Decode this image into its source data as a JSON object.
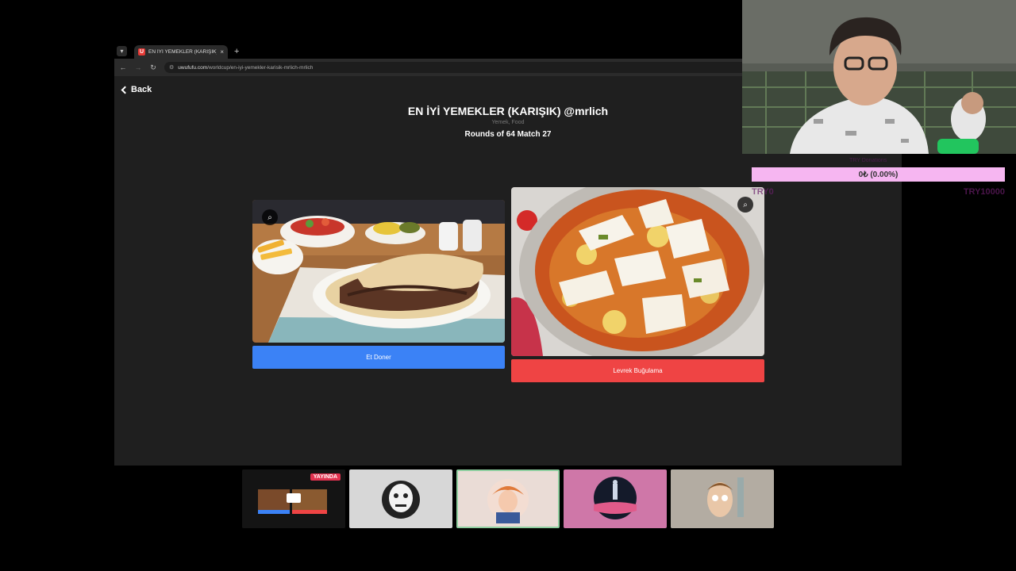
{
  "browser": {
    "tab_title": "EN İYİ YEMEKLER (KARIŞIK) @m",
    "tab_close": "×",
    "new_tab": "+",
    "url_domain": "uwufufu.com",
    "url_path": "/worldcup/en-iyi-yemekler-karisik-mrlich-mrlich"
  },
  "page": {
    "back_label": "Back",
    "title": "EN İYİ YEMEKLER (KARIŞIK) @mrlich",
    "subtitle": "Yemek, Food",
    "rounds": "Rounds of 64 Match 27"
  },
  "choices": [
    {
      "label": "Et Doner",
      "color": "#3b82f6"
    },
    {
      "label": "Levrek Buğulama",
      "color": "#ef4444"
    }
  ],
  "overlay": {
    "donation_top": "TRY Donations",
    "donation_value": "0₺ (0.00%)",
    "donation_left": "TRY0",
    "donation_goal": "TRY10000"
  },
  "participants": {
    "live_badge": "YAYINDA"
  },
  "colors": {
    "page_bg": "#1f1f1f",
    "donation_bar": "#f6b6f1"
  }
}
